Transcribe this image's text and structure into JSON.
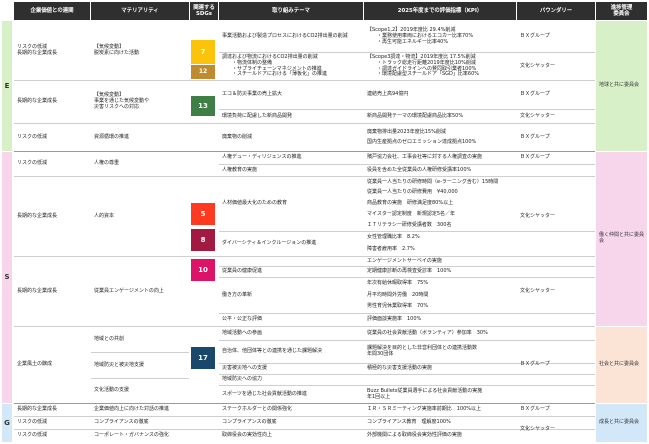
{
  "headers": {
    "corp_value": "企業価値との連関",
    "materiality": "マテリアリティ",
    "sdgs": "関連する\nSDGs",
    "theme": "取り組みテーマ",
    "kpi": "2025年度までの評価指標（KPI）",
    "boundary": "バウンダリー",
    "committee": "進捗管理\n委員会"
  },
  "esg": {
    "E": "E",
    "S": "S",
    "G": "G"
  },
  "colors": {
    "E": "#d8f0c8",
    "S": "#f7d6ec",
    "G": "#d2e7f8",
    "sdg7": "#fcc30b",
    "sdg12": "#bf8b2e",
    "sdg13": "#3f7e44",
    "sdg5": "#ff3a21",
    "sdg8": "#a21942",
    "sdg10": "#dd1367",
    "sdg17": "#19486a"
  },
  "committees": {
    "E": "地球と共に委員会",
    "S1": "働く仲間と共に委員会",
    "S2": "社会と共に委員会",
    "G": "成長と共に委員会"
  },
  "sdg_numbers": {
    "n7": "7",
    "n12": "12",
    "n13": "13",
    "n5": "5",
    "n8": "8",
    "n10": "10",
    "n17": "17"
  },
  "rows": {
    "e1": {
      "corp": "リスクの低減\n長期的な企業成長",
      "mat": "【気候変動】\n脱炭素に向けた活動"
    },
    "e1t1": {
      "theme": "事業活動および製造プロセスにおけるCO2排出量の削減",
      "kpi": [
        "【Scope1,2】2019年度比 29.4%削減",
        "・業務使用車両におけるエコカー比率70%",
        "・再生可能エネルギー比率40%"
      ],
      "boundary": "ＢＸグループ"
    },
    "e1t2": {
      "theme": [
        "調達および物流におけるCO2排出量の削減",
        "・物流体制の整備",
        "・サプライチェーンマネジメントの推進",
        "・スチールドアにおける「薄板化」の推進"
      ],
      "kpi": [
        "【Scope3調達・物流】2019年度比 17.5%削減",
        "・トラック総走行距離2019年度比10%削減",
        "・調達ガイドラインへの賛同取引業者100%",
        "・環境配慮型スチールドア「SGD」比率60%"
      ],
      "boundary": "文化シヤッター"
    },
    "e2": {
      "corp": "長期的な企業成長",
      "mat": "【気候変動】\n事業を通じた気候変動や\n災害リスクへの対応"
    },
    "e2t1": {
      "theme": "エコ＆防災事業の売上拡大",
      "kpi": "連結売上高94億円",
      "boundary": "ＢＸグループ"
    },
    "e2t2": {
      "theme": "環境負荷に配慮した新商品開発",
      "kpi": "新商品開発テーマの環境配慮商品比率50%",
      "boundary": "文化シヤッター"
    },
    "e3": {
      "corp": "リスクの低減",
      "mat": "資源循環の推進"
    },
    "e3t1": {
      "theme": "廃棄物の削減",
      "kpi": [
        "廃棄物排出量2023年度比15%削減",
        "国内生産拠点のゼロエミッション達成拠点100%"
      ],
      "boundary": "ＢＸグループ"
    },
    "s1": {
      "corp": "リスクの低減",
      "mat": "人権の尊重"
    },
    "s1t1": {
      "theme": "人権デュー・ディリジェンスの推進",
      "kpi": "殯戸協力会社、工事会社等に対する人権調査の実施",
      "boundary": "ＢＸグループ"
    },
    "s1t2": {
      "theme": "人権教育の実施",
      "kpi": "役員を含めた全従業員の人権研修受講率100%"
    },
    "s2": {
      "corp": "長期的な企業成長",
      "mat": "人的資本"
    },
    "s2t1": {
      "theme": "人材価値最大化のための教育",
      "kpi": [
        "従業員一人当たりの研修時間（e-ラーニング含む）15時間",
        "従業員一人当たりの研修費用　¥40,000",
        "商品教育の実施　研修満足度80%以上",
        "マイスター認定制度　新規認定5名／年",
        "ＩＴリテラシー研修受講者数　300名"
      ]
    },
    "s2t2": {
      "theme": "ダイバーシティ＆インクルージョンの推進",
      "kpi": [
        "女性管理職比率　8.2%",
        "障害者雇用率　2.7%"
      ],
      "boundary": "文化シヤッター"
    },
    "s3": {
      "corp": "長期的な企業成長",
      "mat": "従業員エンゲージメントの向上"
    },
    "s3t0": {
      "kpi": "エンゲージメントサーベイの実施"
    },
    "s3t1": {
      "theme": "従業員の健康促進",
      "kpi": "定期健康診断の再検査受診率　100%"
    },
    "s3t2": {
      "theme": "働き方の革新",
      "kpi": [
        "年次有給休暇取得率　75%",
        "月平均時間外労働　20時間",
        "男性育児休業取得率　70%"
      ],
      "boundary": "文化シヤッター"
    },
    "s3t3": {
      "theme": "公平・公正な評価",
      "kpi": "評価面談実施率　100%"
    },
    "s4": {
      "corp": "企業風土の醸成",
      "mat_a": "地域との共創",
      "mat_b": "地域防災と被災地支援",
      "mat_c": "文化活動の支援"
    },
    "s4t1": {
      "theme": "地域活動への参画",
      "kpi": "従業員の社会貢献活動（ボランティア）参加率　30%"
    },
    "s4t2": {
      "theme": "自治体、他団体等との連携を通じた課題解決",
      "kpi": [
        "課題解決を目的とした非営利団体との連携活動数",
        "年間30団体"
      ],
      "boundary": "ＢＸグループ"
    },
    "s4t3": {
      "theme": "災害被災地への支援",
      "kpi": "積極的な災害支援活動の実施"
    },
    "s4t4": {
      "theme": "地域防災への協力"
    },
    "s4t5": {
      "theme": "スポーツを通じた社会貢献活動の推進",
      "kpi": [
        "Buzz Bullets従業員選手による社会貢献活動の実施",
        "年1回以上"
      ]
    },
    "g1": {
      "corp": "長期的な企業成長",
      "mat": "企業価値向上に向けた対話の推進",
      "theme": "ステークホルダーとの関係強化",
      "kpi": "ＩＲ・ＳＲミーティング実施率前期比　100%以上",
      "boundary": "ＢＸグループ"
    },
    "g2": {
      "corp": "リスクの低減",
      "mat": "コンプライアンスの徹底",
      "theme": "コンプライアンスの徹底",
      "kpi": "コンプライアンス教育　理解度100%",
      "boundary": "文化シヤッター"
    },
    "g3": {
      "corp": "リスクの低減",
      "mat": "コーポレート・ガバナンスの強化",
      "theme": "取締役会の実効性向上",
      "kpi": "外部機関による取締役会実効性評価の実施"
    }
  }
}
